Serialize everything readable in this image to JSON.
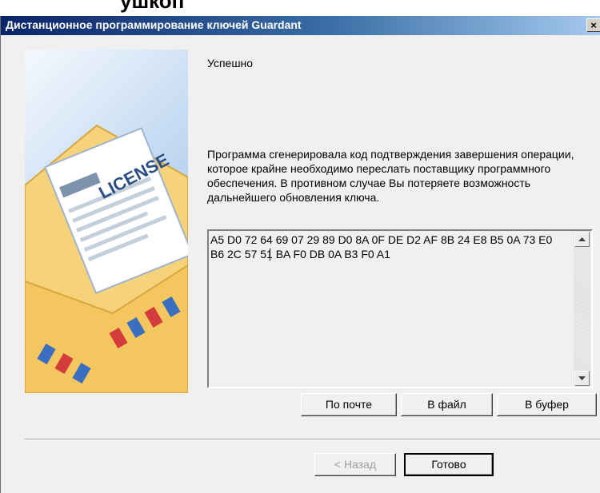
{
  "background": {
    "partial_text": "ушкоп"
  },
  "window": {
    "title": "Дистанционное программирование ключей Guardant",
    "close_label": "×"
  },
  "side_image": {
    "license_label": "LICENSE"
  },
  "content": {
    "heading": "Успешно",
    "description": "Программа сгенерировала код подтверждения завершения операции, которое крайне необходимо переслать поставщику программного обеспечения. В противном случае Вы потеряете возможность дальнейшего обновления ключа.",
    "code": "A5 D0 72 64 69 07 29 89 D0 8A 0F DE D2 AF 8B 24 E8 B5 0A 73 E0 B6 2C 57 51 BA F0 DB 0A B3 F0 A1"
  },
  "actions": {
    "by_mail": "По почте",
    "to_file": "В файл",
    "to_buffer": "В буфер"
  },
  "nav": {
    "back": "< Назад",
    "done": "Готово"
  },
  "colors": {
    "titlebar_start": "#0a246a",
    "titlebar_end": "#a6caf0",
    "dialog_bg": "#f0f0f0"
  }
}
